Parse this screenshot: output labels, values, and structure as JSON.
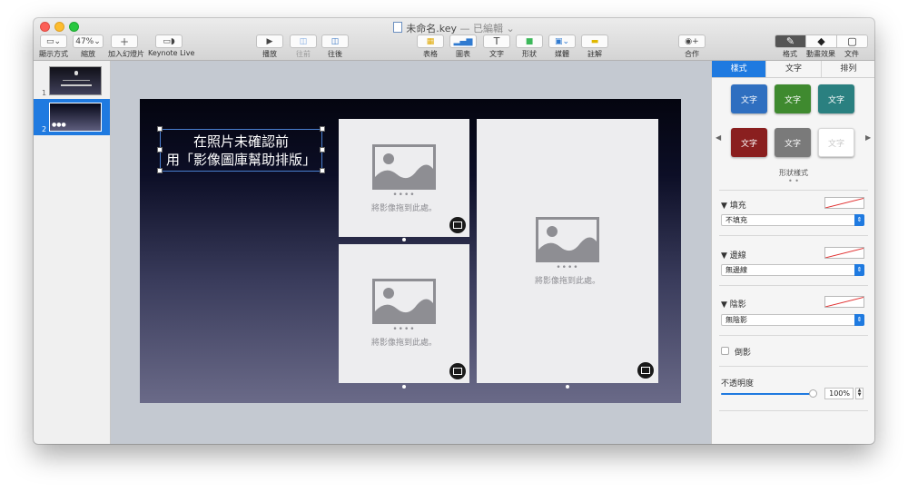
{
  "window": {
    "doc_name": "未命名.key",
    "doc_status": "— 已編輯 ⌄"
  },
  "toolbar": {
    "view_label": "顯示方式",
    "zoom_value": "47%",
    "zoom_label": "縮放",
    "add_slide_label": "加入幻燈片",
    "keynote_live_label": "Keynote Live",
    "play_label": "播放",
    "back_label": "往前",
    "forward_label": "往後",
    "table_label": "表格",
    "chart_label": "圖表",
    "text_label": "文字",
    "shape_label": "形狀",
    "media_label": "媒體",
    "comment_label": "註解",
    "collaborate_label": "合作",
    "format_label": "格式",
    "animate_label": "動畫效果",
    "document_label": "文件"
  },
  "navigator": {
    "slides": [
      {
        "number": "1",
        "selected": false
      },
      {
        "number": "2",
        "selected": true
      }
    ]
  },
  "slide": {
    "title_line1": "在照片未確認前",
    "title_line2": "用「影像圖庫幫助排版」",
    "placeholder_text": "將影像拖到此處。",
    "placeholder_dots": "••••"
  },
  "inspector": {
    "tabs": [
      "樣式",
      "文字",
      "排列"
    ],
    "active_tab": "樣式",
    "style_swatch_text": "文字",
    "styles": [
      {
        "color": "#2f6fc0"
      },
      {
        "color": "#3f8a2f"
      },
      {
        "color": "#2a8080"
      },
      {
        "color": "#8a1f1f"
      },
      {
        "color": "#7a7a7a"
      },
      {
        "color": "#ffffff"
      }
    ],
    "styles_caption": "形狀樣式",
    "page_dots": "• •",
    "fill_label": "填充",
    "fill_value": "不填充",
    "border_label": "邊線",
    "border_value": "無邊線",
    "shadow_label": "陰影",
    "shadow_value": "無陰影",
    "reflection_label": "倒影",
    "opacity_label": "不透明度",
    "opacity_value": "100%",
    "opacity_fraction": 1.0
  }
}
